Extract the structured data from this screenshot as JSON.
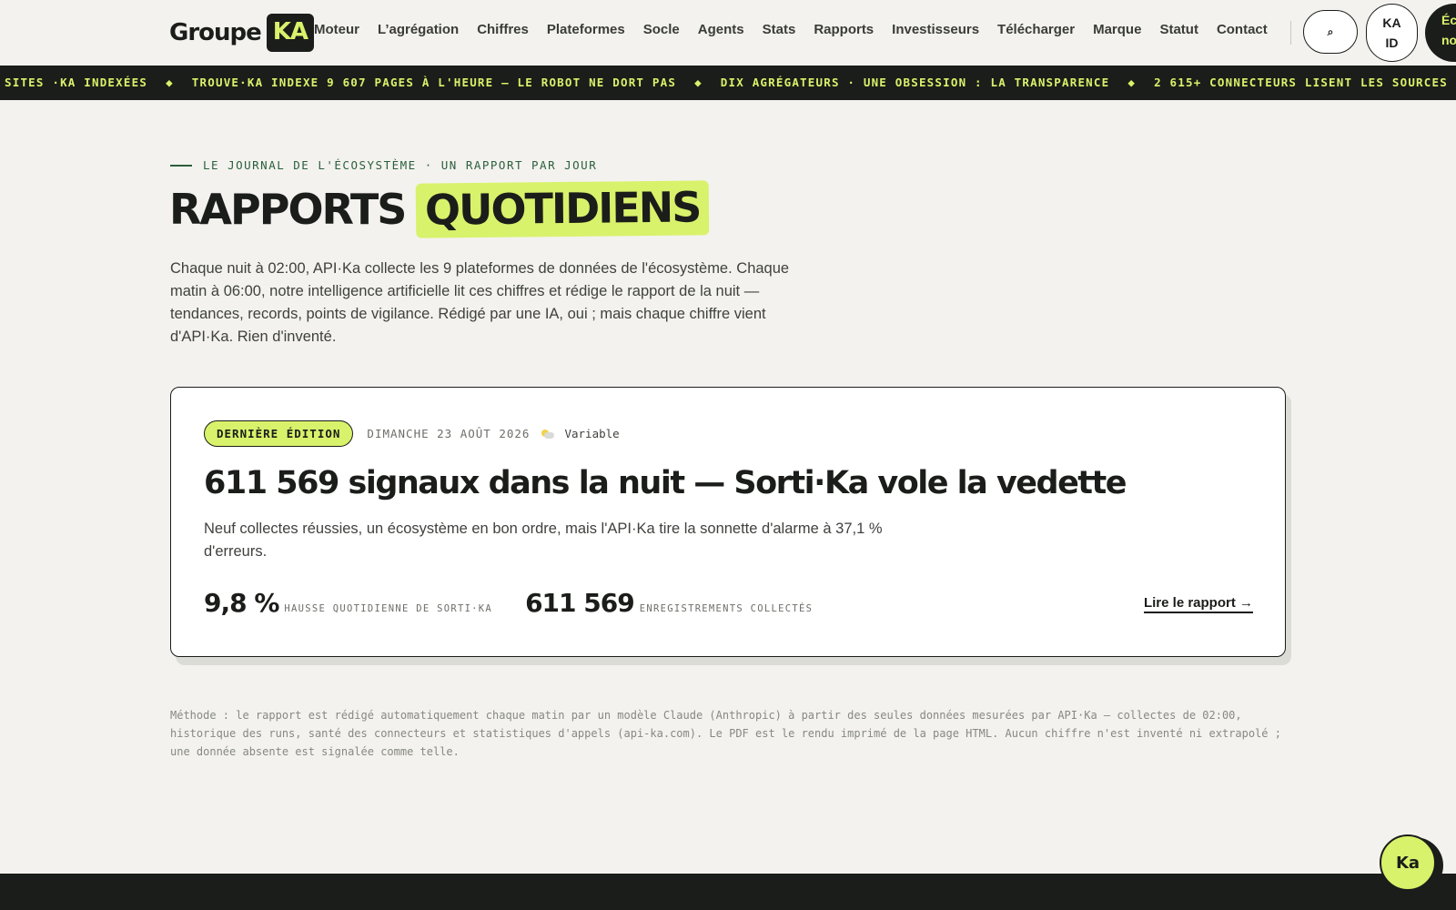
{
  "header": {
    "logo_text": "Groupe",
    "logo_badge": "KA",
    "nav": [
      "Moteur",
      "L’agrégation",
      "Chiffres",
      "Plateformes",
      "Socle",
      "Agents",
      "Stats",
      "Rapports",
      "Investisseurs",
      "Télécharger",
      "Marque",
      "Statut",
      "Contact"
    ],
    "search_icon": "⌕",
    "kaid_line1": "KA",
    "kaid_line2": "ID",
    "eco_line1": "Éco",
    "eco_line2": "no"
  },
  "ticker": {
    "items": [
      "SITES ·KA INDEXÉES",
      "TROUVE·KA INDEXE 9 607 PAGES À L'HEURE — LE ROBOT NE DORT PAS",
      "DIX AGRÉGATEURS · UNE OBSESSION : LA TRANSPARENCE",
      "2 615+ CONNECTEURS LISENT LES SOURCES"
    ],
    "separator": "◆"
  },
  "hero": {
    "eyebrow": "LE JOURNAL DE L'ÉCOSYSTÈME · UN RAPPORT PAR JOUR",
    "title_plain": "RAPPORTS",
    "title_highlight": "QUOTIDIENS",
    "intro": "Chaque nuit à 02:00, API·Ka collecte les 9 plateformes de données de l'écosystème. Chaque matin à 06:00, notre intelligence artificielle lit ces chiffres et rédige le rapport de la nuit — tendances, records, points de vigilance. Rédigé par une IA, oui ; mais chaque chiffre vient d'API·Ka. Rien d'inventé."
  },
  "card": {
    "badge": "DERNIÈRE ÉDITION",
    "date": "DIMANCHE 23 AOÛT 2026",
    "weather_icon": "sun-behind-cloud-icon",
    "weather": "Variable",
    "title": "611 569 signaux dans la nuit — Sorti·Ka vole la vedette",
    "summary": "Neuf collectes réussies, un écosystème en bon ordre, mais l'API·Ka tire la sonnette d'alarme à 37,1 % d'erreurs.",
    "stats": [
      {
        "value": "9,8 %",
        "label": "HAUSSE QUOTIDIENNE DE SORTI·KA"
      },
      {
        "value": "611 569",
        "label": "ENREGISTREMENTS COLLECTÉS"
      }
    ],
    "read_link": "Lire le rapport →"
  },
  "method": "Méthode : le rapport est rédigé automatiquement chaque matin par un modèle Claude (Anthropic) à partir des seules données mesurées par API·Ka — collectes de 02:00, historique des runs, santé des connecteurs et statistiques d'appels (api-ka.com). Le PDF est le rendu imprimé de la page HTML. Aucun chiffre n'est inventé ni extrapolé ; une donnée absente est signalée comme telle.",
  "fab": {
    "label": "Ka"
  },
  "colors": {
    "accent": "#d8f26b",
    "ink": "#1b1d1a",
    "background": "#f3f2ee",
    "eyebrow": "#2b5f3c"
  }
}
